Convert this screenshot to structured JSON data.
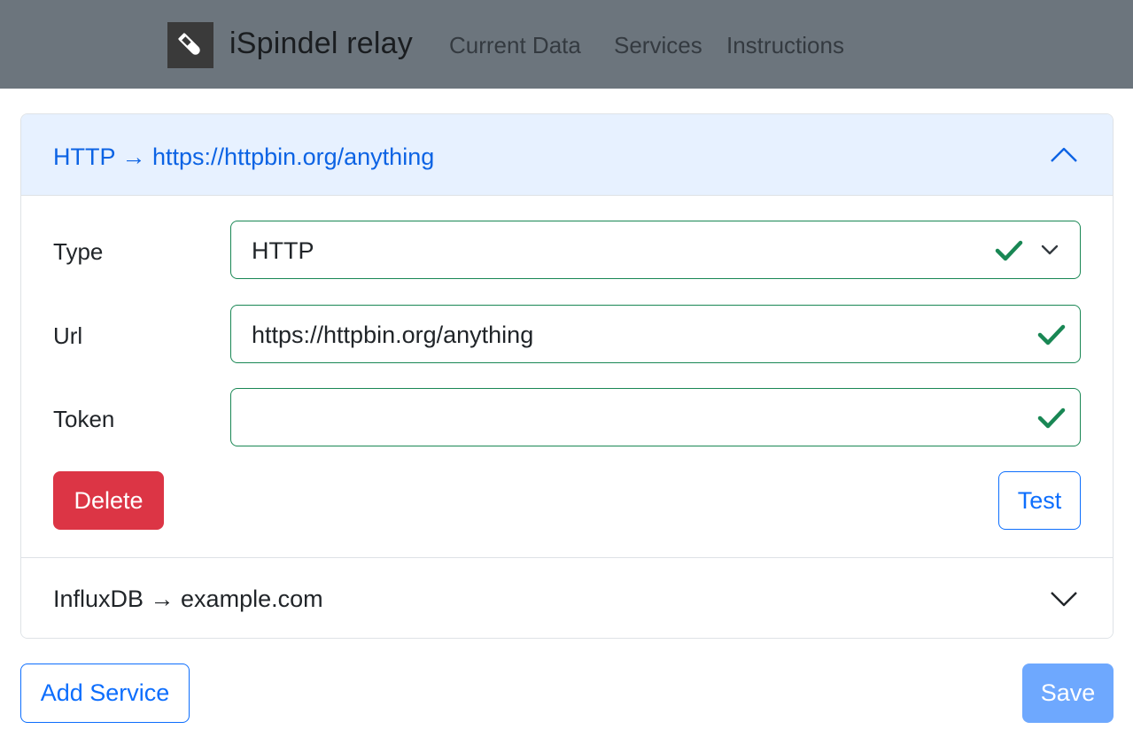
{
  "navbar": {
    "brand": "iSpindel relay",
    "logo_icon": "test-tube-icon",
    "links": [
      "Current Data",
      "Services",
      "Instructions"
    ]
  },
  "services": [
    {
      "header": "HTTP → https://httpbin.org/anything",
      "expanded": true,
      "fields": {
        "type_label": "Type",
        "type_value": "HTTP",
        "url_label": "Url",
        "url_value": "https://httpbin.org/anything",
        "token_label": "Token",
        "token_value": ""
      },
      "delete_label": "Delete",
      "test_label": "Test"
    },
    {
      "header": "InfluxDB → example.com",
      "expanded": false
    }
  ],
  "actions": {
    "add_service_label": "Add Service",
    "save_label": "Save"
  },
  "colors": {
    "navbar_bg": "#6c757d",
    "primary": "#0d6efd",
    "danger": "#dc3545",
    "valid": "#198754",
    "accordion_active_bg": "#e7f1ff",
    "save_disabled_bg": "#6ea8fe"
  }
}
